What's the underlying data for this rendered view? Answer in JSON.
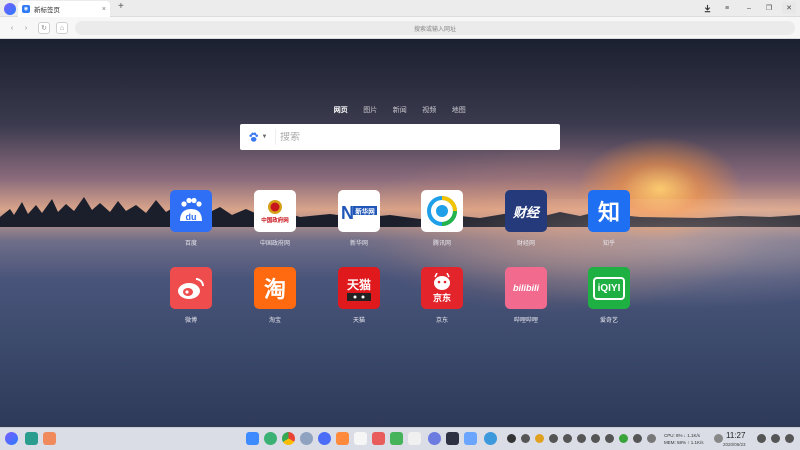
{
  "browser": {
    "tab_title": "新标签页",
    "tab_close": "×",
    "new_tab": "+",
    "address_placeholder": "搜索或输入网址",
    "icons": [
      "app-logo-icon",
      "download-icon",
      "menu-icon",
      "minimize-icon",
      "maximize-icon",
      "close-icon",
      "back-icon",
      "forward-icon",
      "reload-icon",
      "home-icon"
    ]
  },
  "search": {
    "tabs": [
      "网页",
      "图片",
      "新闻",
      "视频",
      "地图"
    ],
    "active_tab": "网页",
    "placeholder": "搜索",
    "engine_icon": "baidu-paw-icon"
  },
  "shortcuts": [
    {
      "label": "百度",
      "glyph": "du",
      "bg": "#2f6ff5"
    },
    {
      "label": "中国政府网",
      "glyph": "中国政府网",
      "bg": "#ffffff"
    },
    {
      "label": "新华网",
      "glyph": "新华网",
      "bg": "#ffffff"
    },
    {
      "label": "腾讯网",
      "glyph": "Q",
      "bg": "#ffffff"
    },
    {
      "label": "财经网",
      "glyph": "财经",
      "bg": "#243a7a"
    },
    {
      "label": "知乎",
      "glyph": "知",
      "bg": "#1e6ff1"
    },
    {
      "label": "微博",
      "glyph": "微",
      "bg": "#ef4d4d"
    },
    {
      "label": "淘宝",
      "glyph": "淘",
      "bg": "#ff6a10"
    },
    {
      "label": "天猫",
      "glyph": "天猫",
      "bg": "#e0191c"
    },
    {
      "label": "京东",
      "glyph": "京东",
      "bg": "#e3242b"
    },
    {
      "label": "哔哩哔哩",
      "glyph": "bilibili",
      "bg": "#f26b8e"
    },
    {
      "label": "爱奇艺",
      "glyph": "iQIYI",
      "bg": "#1fb043"
    }
  ],
  "taskbar": {
    "cpu_line": "CPU: 8%  ↓ 1.1K/s",
    "mem_line": "MEM: 58%  ↑ 1.1K/s",
    "time": "11:27",
    "date": "2020/06/23"
  }
}
